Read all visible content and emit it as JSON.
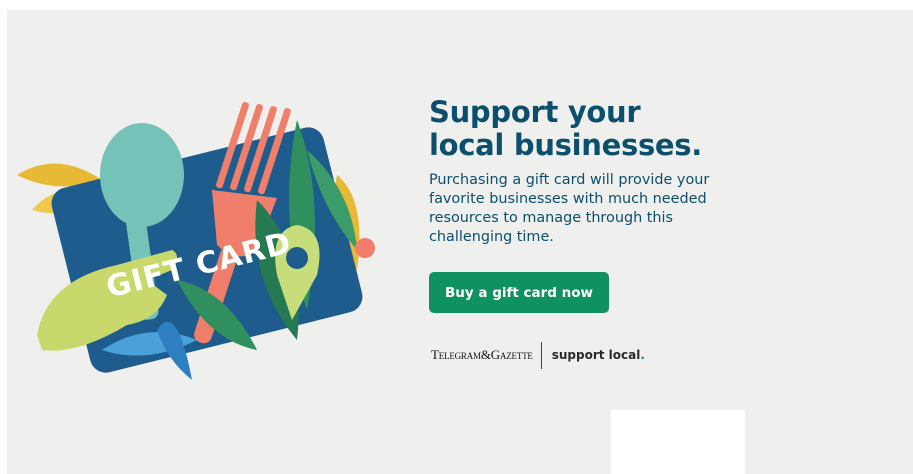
{
  "banner": {
    "artwork": {
      "card_label": "GIFT CARD",
      "colors": {
        "card": "#1d5c8d",
        "fork": "#ef7e6a",
        "spoon": "#74c2b8",
        "leaf_green": "#2f8f5e",
        "leaf_yellow": "#e8b934",
        "pin": "#c7dd7c"
      }
    },
    "headline_line1": "Support your",
    "headline_line2": "local businesses.",
    "description": "Purchasing a gift card will provide your favorite businesses with much needed resources to manage through this challenging time.",
    "cta_label": "Buy a gift card now",
    "brand": {
      "masthead": "Telegram&Gazette",
      "tagline": "support local",
      "tagline_dot": "."
    },
    "colors": {
      "background": "#efefed",
      "heading": "#0c4f6c",
      "button": "#0f9160"
    }
  }
}
